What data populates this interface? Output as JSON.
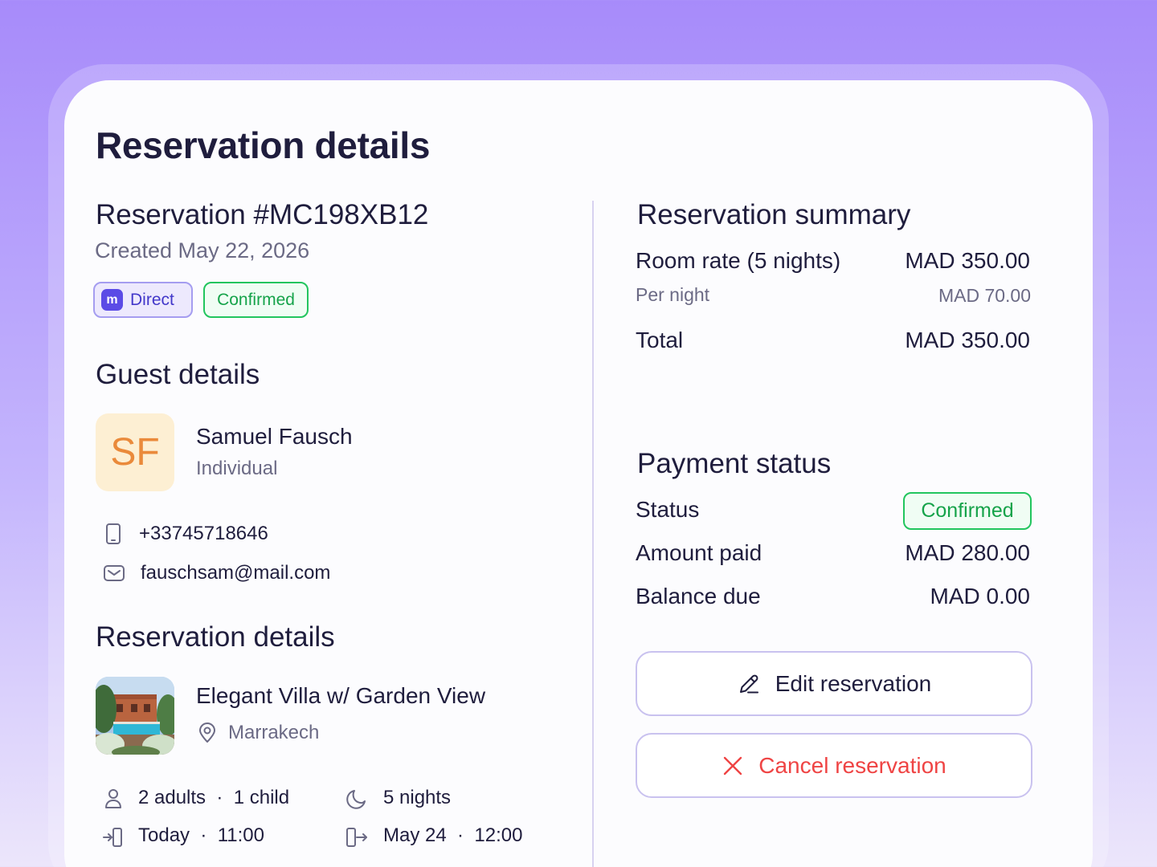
{
  "page_title": "Reservation details",
  "reservation": {
    "heading": "Reservation #MC198XB12",
    "created": "Created May 22, 2026",
    "badges": {
      "direct_logo": "m",
      "direct": "Direct",
      "confirmed": "Confirmed"
    }
  },
  "guest": {
    "section_title": "Guest details",
    "initials": "SF",
    "name": "Samuel Fausch",
    "type": "Individual",
    "phone": "+33745718646",
    "email": "fauschsam@mail.com"
  },
  "details": {
    "section_title": "Reservation details",
    "property_name": "Elegant Villa w/ Garden View",
    "location": "Marrakech",
    "guests": "2 adults  ·  1 child",
    "nights": "5 nights",
    "checkin": "Today  ·  11:00",
    "checkout": "May 24  ·  12:00"
  },
  "summary": {
    "title": "Reservation summary",
    "room_rate_label": "Room rate (5 nights)",
    "room_rate_value": "MAD 350.00",
    "per_night_label": "Per night",
    "per_night_value": "MAD 70.00",
    "total_label": "Total",
    "total_value": "MAD 350.00"
  },
  "payment": {
    "title": "Payment status",
    "status_label": "Status",
    "status_value": "Confirmed",
    "paid_label": "Amount paid",
    "paid_value": "MAD 280.00",
    "balance_label": "Balance due",
    "balance_value": "MAD 0.00"
  },
  "actions": {
    "edit": "Edit reservation",
    "cancel": "Cancel reservation"
  },
  "colors": {
    "accent": "#5b4be6",
    "success": "#16a34a",
    "danger": "#ef4444",
    "avatar_bg": "#fdefd3",
    "avatar_text": "#ea8a3b"
  }
}
